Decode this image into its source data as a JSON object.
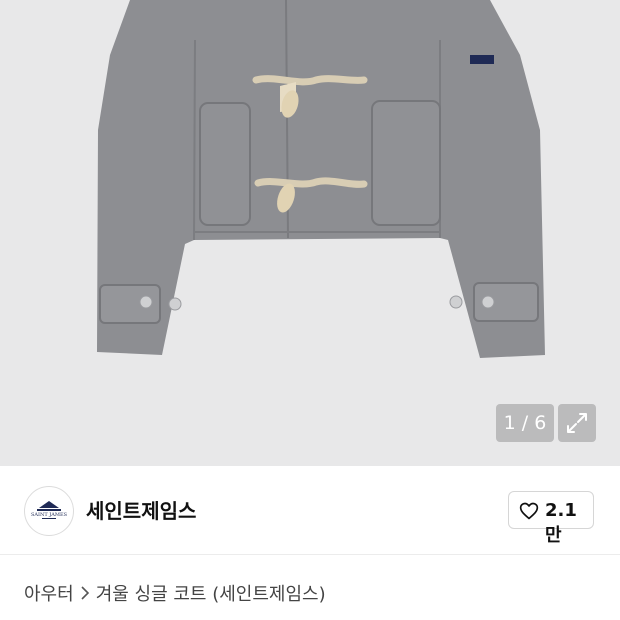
{
  "gallery": {
    "counter": "1 / 6",
    "expand_icon": "expand-icon"
  },
  "brand": {
    "name": "세인트제임스",
    "logo_text": "SAINT JAMES",
    "like_count": "2.1만",
    "like_icon": "heart-outline-icon"
  },
  "breadcrumb": {
    "category": "아우터",
    "separator_icon": "chevron-right-icon",
    "product": "겨울 싱글 코트 (세인트제임스)"
  },
  "colors": {
    "hero_bg": "#e8e8e9",
    "coat": "#8d8e92",
    "toggle": "#d8cdb4"
  }
}
